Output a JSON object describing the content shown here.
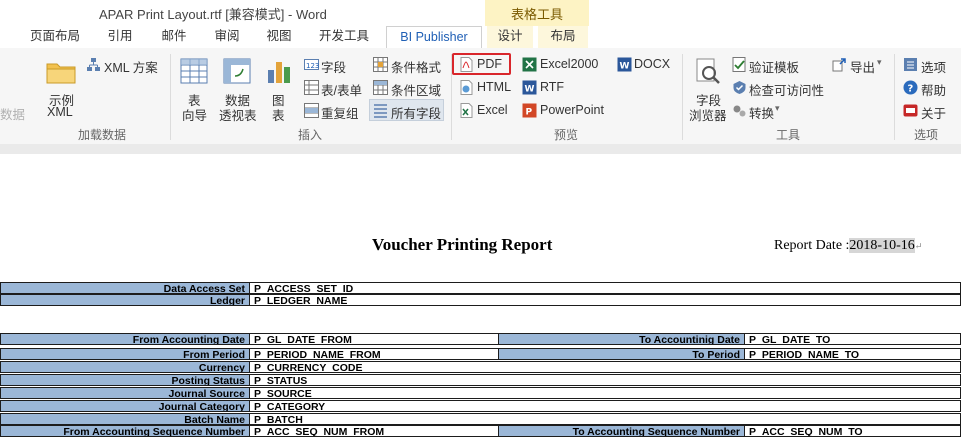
{
  "titlebar": {
    "title": "APAR Print Layout.rtf [兼容模式] - Word",
    "context_group": "表格工具"
  },
  "tabs": [
    {
      "label": "页面布局"
    },
    {
      "label": "引用"
    },
    {
      "label": "邮件"
    },
    {
      "label": "审阅"
    },
    {
      "label": "视图"
    },
    {
      "label": "开发工具"
    },
    {
      "label": "BI Publisher"
    },
    {
      "label": "设计"
    },
    {
      "label": "布局"
    }
  ],
  "ribbon": {
    "load": {
      "cut_label": "数据",
      "sample_xml": [
        "示例",
        "XML"
      ],
      "xml_schema": "XML 方案",
      "group": "加载数据"
    },
    "insert": {
      "table_wizard": [
        "表",
        "向导"
      ],
      "pivot_table": [
        "数据",
        "透视表"
      ],
      "chart": [
        "图",
        "表"
      ],
      "field": "字段",
      "table_form": "表/表单",
      "repeat_group": "重复组",
      "conditional_format": "条件格式",
      "conditional_region": "条件区域",
      "all_fields": "所有字段",
      "group": "插入"
    },
    "preview": {
      "pdf": "PDF",
      "html": "HTML",
      "excel": "Excel",
      "excel2000": "Excel2000",
      "rtf": "RTF",
      "powerpoint": "PowerPoint",
      "docx": "DOCX",
      "group": "预览"
    },
    "tools": {
      "field_browser": [
        "字段",
        "浏览器"
      ],
      "validate_template": "验证模板",
      "check_accessibility": "检查可访问性",
      "convert": "转换",
      "export": "导出",
      "group": "工具"
    },
    "options": {
      "options": "选项",
      "help": "帮助",
      "about": "关于",
      "group": "选项"
    }
  },
  "colors": {
    "accent": "#1f5fb5",
    "highlight": "#d9262b",
    "label_fill": "#9bb7d7",
    "context_tab": "#fdf3c4"
  },
  "document": {
    "title": "Voucher Printing Report",
    "date_label": "Report Date :",
    "date_value": "2018-10-16",
    "rows": [
      {
        "label": "Data Access Set",
        "value": "P_ACCESS_SET_ID"
      },
      {
        "label": "Ledger",
        "value": "P_LEDGER_NAME"
      },
      {
        "label": "From Accounting Date",
        "value": "P_GL_DATE_FROM",
        "label2": "To Accountinig Date",
        "value2": "P_GL_DATE_TO"
      },
      {
        "label": "From Period",
        "value": "P_PERIOD_NAME_FROM",
        "label2": "To Period",
        "value2": "P_PERIOD_NAME_TO"
      },
      {
        "label": "Currency",
        "value": "P_CURRENCY_CODE"
      },
      {
        "label": "Posting Status",
        "value": "P_STATUS"
      },
      {
        "label": "Journal Source",
        "value": "P_SOURCE"
      },
      {
        "label": "Journal Category",
        "value": "P_CATEGORY"
      },
      {
        "label": "Batch Name",
        "value": "P_BATCH"
      },
      {
        "label": "From Accounting Sequence Number",
        "value": "P_ACC_SEQ_NUM_FROM",
        "label2": "To Accounting Sequence Number",
        "value2": "P_ACC_SEQ_NUM_TO"
      }
    ]
  }
}
